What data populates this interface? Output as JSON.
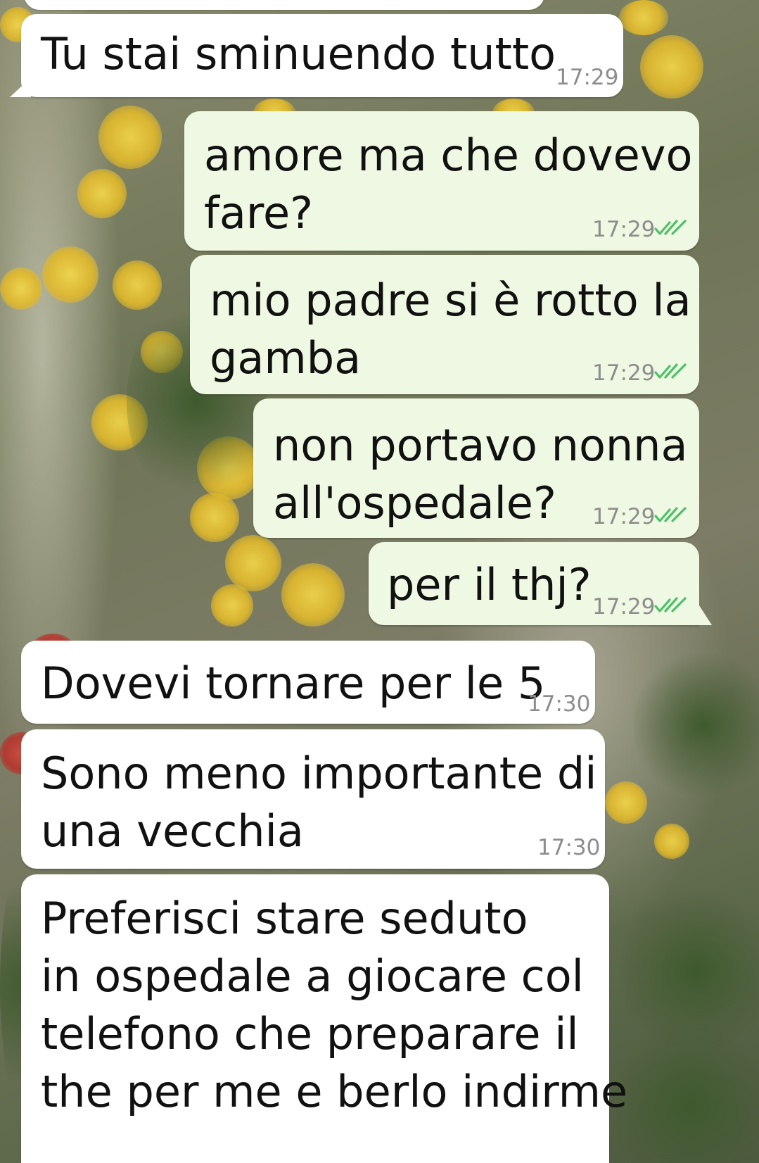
{
  "colors": {
    "incoming_bubble": "#ffffff",
    "outgoing_bubble": "#eef8e2",
    "timestamp": "#8d8d8d",
    "read_ticks": "#4fbf6a"
  },
  "messages": [
    {
      "direction": "incoming",
      "text": "Tu stai sminuendo tutto",
      "time": "17:29"
    },
    {
      "direction": "outgoing",
      "text": "amore ma che dovevo\nfare?",
      "time": "17:29",
      "status_icon": "double-check-icon"
    },
    {
      "direction": "outgoing",
      "text": "mio padre si è rotto la\ngamba",
      "time": "17:29",
      "status_icon": "double-check-icon"
    },
    {
      "direction": "outgoing",
      "text": "non portavo nonna\nall'ospedale?",
      "time": "17:29",
      "status_icon": "double-check-icon"
    },
    {
      "direction": "outgoing",
      "text": "per il thj?",
      "time": "17:29",
      "status_icon": "double-check-icon"
    },
    {
      "direction": "incoming",
      "text": "Dovevi tornare per le 5",
      "time": "17:30"
    },
    {
      "direction": "incoming",
      "text": "Sono meno importante di\nuna vecchia",
      "time": "17:30"
    },
    {
      "direction": "incoming",
      "text": "Preferisci stare seduto\nin ospedale a giocare col\ntelefono che preparare il\nthe per me e berlo indirme"
    }
  ]
}
